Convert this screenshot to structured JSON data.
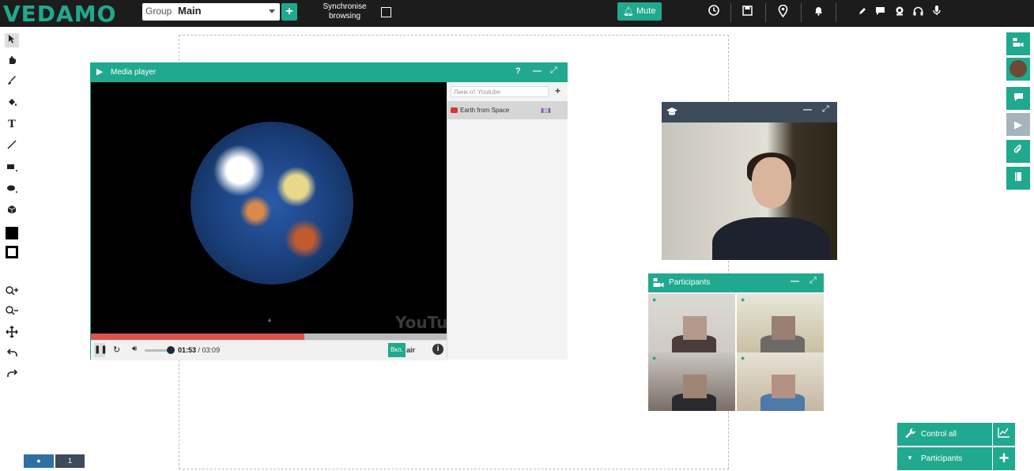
{
  "app": {
    "logo": "VEDAMO"
  },
  "topbar": {
    "group_label": "Group",
    "group_value": "Main",
    "group_add": "+",
    "sync_label": "Synchronise browsing",
    "mute_label": "Mute",
    "icons": [
      "clock-icon",
      "save-icon",
      "location-icon",
      "bell-icon",
      "pen-icon",
      "chat-icon",
      "user-icon",
      "headphones-icon",
      "mic-icon"
    ]
  },
  "left_toolbar": {
    "tools": [
      "select",
      "hand",
      "brush",
      "paint-bucket",
      "text",
      "line",
      "rectangle",
      "ellipse",
      "cube",
      "fill-color",
      "stroke-color",
      "zoom-in",
      "zoom-out",
      "move",
      "undo",
      "redo"
    ]
  },
  "media_player": {
    "title": "Media player",
    "help": "?",
    "youtube_placeholder": "Линк от Youtube",
    "add": "+",
    "playlist": [
      {
        "title": "Earth from Space"
      }
    ],
    "progress_fraction": 0.6,
    "time_current": "01:53",
    "time_total": "03:09",
    "air_button": "Вкл.",
    "air_label": "air",
    "watermark": "YouTube"
  },
  "participants_panel": {
    "title": "Participants"
  },
  "bottom_right": {
    "control_all": "Control all",
    "participants": "Participants",
    "add": "+"
  },
  "page_indicator": {
    "dot": "●",
    "page": "1"
  },
  "colors": {
    "accent": "#20a98e",
    "dark": "#1c1c1c",
    "cam_header": "#3d4a5a"
  }
}
